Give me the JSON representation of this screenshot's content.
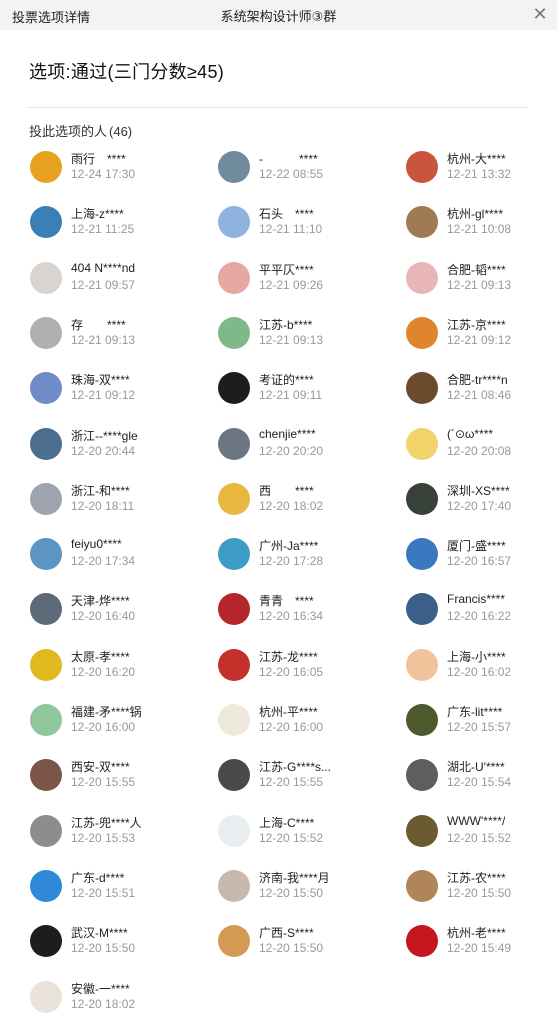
{
  "window": {
    "title": "投票选项详情",
    "group_name": "系统架构设计师③群",
    "close_label": "✕"
  },
  "option": {
    "label": "选项:通过(三门分数≥45)"
  },
  "voters_header": {
    "label": "投此选项的人",
    "count": "(46)"
  },
  "voters": [
    {
      "name": "雨行　****",
      "time": "12-24 17:30",
      "avatar_color": "#e8a21f",
      "avatar_icon": "bear-icon"
    },
    {
      "name": "-　　　****",
      "time": "12-22 08:55",
      "avatar_color": "#6f8b9c",
      "avatar_icon": "landscape-icon"
    },
    {
      "name": "杭州-大****",
      "time": "12-21 13:32",
      "avatar_color": "#c9553c",
      "avatar_icon": "egg-icon"
    },
    {
      "name": "上海-z****",
      "time": "12-21 11:25",
      "avatar_color": "#3c7fb6",
      "avatar_icon": "plane-icon"
    },
    {
      "name": "石头　****",
      "time": "12-21 11:10",
      "avatar_color": "#8fb3de",
      "avatar_icon": "tower-icon"
    },
    {
      "name": "杭州-gl****",
      "time": "12-21 10:08",
      "avatar_color": "#a07a52",
      "avatar_icon": "cat-icon"
    },
    {
      "name": "404 N****nd",
      "time": "12-21 09:57",
      "avatar_color": "#d9d4d0",
      "avatar_icon": "sketch-icon"
    },
    {
      "name": "平平仄****",
      "time": "12-21 09:26",
      "avatar_color": "#e7a7a2",
      "avatar_icon": "cartoon-icon"
    },
    {
      "name": "合肥-韬****",
      "time": "12-21 09:13",
      "avatar_color": "#e8b6b8",
      "avatar_icon": "baby-icon"
    },
    {
      "name": "存　　****",
      "time": "12-21 09:13",
      "avatar_color": "#b0b0b0",
      "avatar_icon": "gray-icon"
    },
    {
      "name": "江苏-b****",
      "time": "12-21 09:13",
      "avatar_color": "#7fb98a",
      "avatar_icon": "girl-icon"
    },
    {
      "name": "江苏-京****",
      "time": "12-21 09:12",
      "avatar_color": "#e0852e",
      "avatar_icon": "anime-icon"
    },
    {
      "name": "珠海-双****",
      "time": "12-21 09:12",
      "avatar_color": "#6f8cc9",
      "avatar_icon": "anime-girl-icon"
    },
    {
      "name": "考证的****",
      "time": "12-21 09:11",
      "avatar_color": "#1d1d1d",
      "avatar_icon": "penguin-icon"
    },
    {
      "name": "合肥-tr****n",
      "time": "12-21 08:46",
      "avatar_color": "#6b4a2e",
      "avatar_icon": "boy-icon"
    },
    {
      "name": "浙江--****gle",
      "time": "12-20 20:44",
      "avatar_color": "#4d6f8f",
      "avatar_icon": "sky-icon"
    },
    {
      "name": "chenjie****",
      "time": "12-20 20:20",
      "avatar_color": "#6c7582",
      "avatar_icon": "mountain-icon"
    },
    {
      "name": "(´⊙ω****",
      "time": "12-20 20:08",
      "avatar_color": "#f2d26b",
      "avatar_icon": "face-icon"
    },
    {
      "name": "浙江-和****",
      "time": "12-20 18:11",
      "avatar_color": "#9ea4ad",
      "avatar_icon": "car-icon"
    },
    {
      "name": "西　　****",
      "time": "12-20 18:02",
      "avatar_color": "#e6b840",
      "avatar_icon": "hair-icon"
    },
    {
      "name": "深圳-XS****",
      "time": "12-20 17:40",
      "avatar_color": "#37413a",
      "avatar_icon": "light-icon"
    },
    {
      "name": "feiyu0****",
      "time": "12-20 17:34",
      "avatar_color": "#5a95c4",
      "avatar_icon": "jet-icon"
    },
    {
      "name": "广州-Ja****",
      "time": "12-20 17:28",
      "avatar_color": "#3d9cc4",
      "avatar_icon": "beach-icon"
    },
    {
      "name": "厦门-盛****",
      "time": "12-20 16:57",
      "avatar_color": "#3b78c0",
      "avatar_icon": "glasses-icon"
    },
    {
      "name": "天津-烨****",
      "time": "12-20 16:40",
      "avatar_color": "#5c6a7a",
      "avatar_icon": "person-icon"
    },
    {
      "name": "青青　****",
      "time": "12-20 16:34",
      "avatar_color": "#b5262a",
      "avatar_icon": "doll-icon"
    },
    {
      "name": "Francis****",
      "time": "12-20 16:22",
      "avatar_color": "#3c5f8a",
      "avatar_icon": "abstract-icon"
    },
    {
      "name": "太原-孝****",
      "time": "12-20 16:20",
      "avatar_color": "#e0b820",
      "avatar_icon": "silhouette-icon"
    },
    {
      "name": "江苏-龙****",
      "time": "12-20 16:05",
      "avatar_color": "#c4302a",
      "avatar_icon": "race-car-icon"
    },
    {
      "name": "上海-小****",
      "time": "12-20 16:02",
      "avatar_color": "#f0c39a",
      "avatar_icon": "pig-icon"
    },
    {
      "name": "福建-矛****锅",
      "time": "12-20 16:00",
      "avatar_color": "#8fc79a",
      "avatar_icon": "head-icon"
    },
    {
      "name": "杭州-平****",
      "time": "12-20 16:00",
      "avatar_color": "#efe8dc",
      "avatar_icon": "kid-icon"
    },
    {
      "name": "广东-lit****",
      "time": "12-20 15:57",
      "avatar_color": "#4c5a2e",
      "avatar_icon": "heart-icon"
    },
    {
      "name": "西安-双****",
      "time": "12-20 15:55",
      "avatar_color": "#7a5548",
      "avatar_icon": "woman-icon"
    },
    {
      "name": "江苏-G****s...",
      "time": "12-20 15:55",
      "avatar_color": "#4a4a4a",
      "avatar_icon": "man-icon"
    },
    {
      "name": "湖北-U'****",
      "time": "12-20 15:54",
      "avatar_color": "#5e5e5e",
      "avatar_icon": "street-icon"
    },
    {
      "name": "江苏-兜****人",
      "time": "12-20 15:53",
      "avatar_color": "#8d8d8d",
      "avatar_icon": "wolf-icon"
    },
    {
      "name": "上海-C****",
      "time": "12-20 15:52",
      "avatar_color": "#e8eef0",
      "avatar_icon": "clock-icon"
    },
    {
      "name": "WWW'****/",
      "time": "12-20 15:52",
      "avatar_color": "#6a5a2e",
      "avatar_icon": "soldier-icon"
    },
    {
      "name": "广东-d****",
      "time": "12-20 15:51",
      "avatar_color": "#2f89d8",
      "avatar_icon": "smile-icon"
    },
    {
      "name": "济南-我****月",
      "time": "12-20 15:50",
      "avatar_color": "#c9b8ae",
      "avatar_icon": "lady-icon"
    },
    {
      "name": "江苏-农****",
      "time": "12-20 15:50",
      "avatar_color": "#b0855a",
      "avatar_icon": "sketch-man-icon"
    },
    {
      "name": "武汉-M****",
      "time": "12-20 15:50",
      "avatar_color": "#1d1d1d",
      "avatar_icon": "penguin-icon"
    },
    {
      "name": "广西-S****",
      "time": "12-20 15:50",
      "avatar_color": "#d49a55",
      "avatar_icon": "dog-icon"
    },
    {
      "name": "杭州-老****",
      "time": "12-20 15:49",
      "avatar_color": "#c4161c",
      "avatar_icon": "ball-icon"
    },
    {
      "name": "安徽-一****",
      "time": "12-20 18:02",
      "avatar_color": "#e9e3dc",
      "avatar_icon": "pug-icon"
    }
  ]
}
